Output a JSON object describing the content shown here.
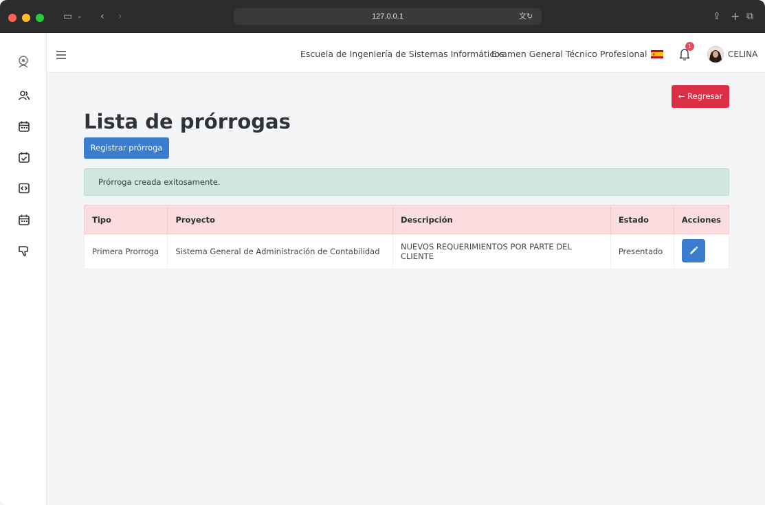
{
  "browser": {
    "url": "127.0.0.1"
  },
  "nav": {
    "school": "Escuela de Ingeniería de Sistemas Informáticos",
    "exam": "Examen General Técnico Profesional",
    "notifications_count": "1",
    "user_name": "CELINA",
    "flag_icon": "spain-flag-icon"
  },
  "sidebar": {
    "items": [
      {
        "icon": "users-icon"
      },
      {
        "icon": "calendar-icon"
      },
      {
        "icon": "calendar-check-icon"
      },
      {
        "icon": "code-icon"
      },
      {
        "icon": "calendar-icon"
      },
      {
        "icon": "thumbs-down-icon"
      }
    ]
  },
  "page": {
    "title": "Lista de prórrogas",
    "back_label": "← Regresar",
    "register_label": "Registrar prórroga",
    "alert": "Prórroga creada exitosamente."
  },
  "table": {
    "headers": [
      "Tipo",
      "Proyecto",
      "Descripción",
      "Estado",
      "Acciones"
    ],
    "rows": [
      {
        "tipo": "Primera Prorroga",
        "proyecto": "Sistema General de Administración de Contabilidad",
        "descripcion": "NUEVOS REQUERIMIENTOS POR PARTE DEL CLIENTE",
        "estado": "Presentado"
      }
    ]
  },
  "colors": {
    "primary": "#3a7ccd",
    "danger": "#dc2f45",
    "success_bg": "#d1e7dd",
    "table_header_bg": "#fbdddf"
  }
}
